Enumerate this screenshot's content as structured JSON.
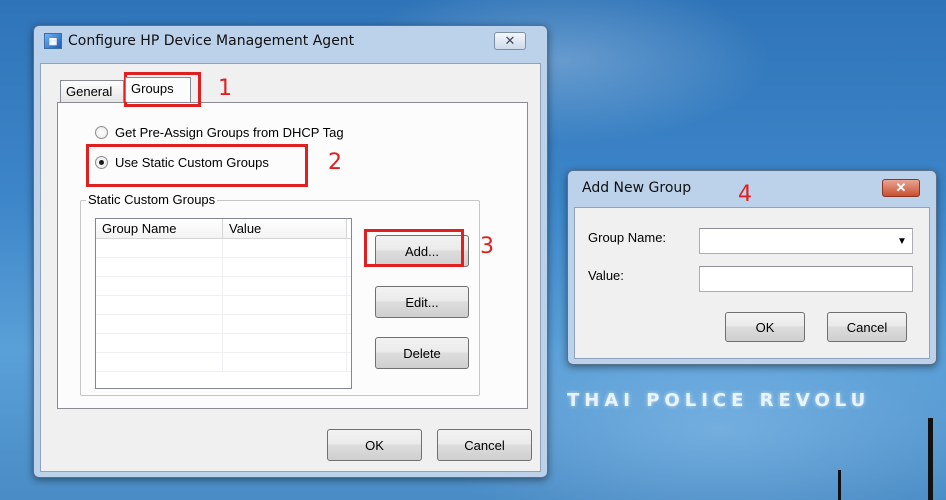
{
  "desktop": {
    "wallpaper_text": "THAI POLICE REVOLU"
  },
  "main_dialog": {
    "title": "Configure HP Device Management Agent",
    "close_symbol": "✕",
    "tabs": [
      {
        "label": "General",
        "active": false
      },
      {
        "label": "Groups",
        "active": true
      }
    ],
    "radio_options": [
      {
        "label": "Get Pre-Assign Groups from DHCP Tag",
        "selected": false
      },
      {
        "label": "Use Static Custom Groups",
        "selected": true
      }
    ],
    "groupbox_label": "Static Custom Groups",
    "list_columns": [
      "Group Name",
      "Value"
    ],
    "buttons": {
      "add": "Add...",
      "edit": "Edit...",
      "delete": "Delete",
      "ok": "OK",
      "cancel": "Cancel"
    }
  },
  "add_group_dialog": {
    "title": "Add New Group",
    "close_symbol": "✕",
    "group_name_label": "Group Name:",
    "group_name_value": "",
    "value_label": "Value:",
    "value_value": "",
    "buttons": {
      "ok": "OK",
      "cancel": "Cancel"
    }
  },
  "annotations": {
    "step1": "1",
    "step2": "2",
    "step3": "3",
    "step4": "4",
    "color": "#e02020"
  }
}
